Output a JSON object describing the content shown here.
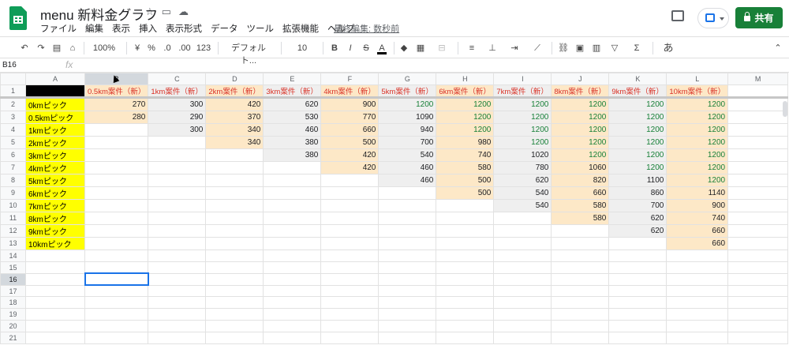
{
  "app": {
    "title": "menu 新料金グラフ",
    "last_edit": "最終編集: 数秒前",
    "share_label": "共有"
  },
  "menu_items": [
    "ファイル",
    "編集",
    "表示",
    "挿入",
    "表示形式",
    "データ",
    "ツール",
    "拡張機能",
    "ヘルプ"
  ],
  "toolbar": {
    "zoom": "100%",
    "currency": "¥",
    "percent": "%",
    "decrease_decimal": ".0",
    "increase_decimal": ".00",
    "number_format": "123",
    "font": "デフォルト...",
    "font_size": "10",
    "input_label": "あ"
  },
  "formula": {
    "cell_ref": "B16",
    "fx_label": "fx"
  },
  "columns": [
    "A",
    "B",
    "C",
    "D",
    "E",
    "F",
    "G",
    "H",
    "I",
    "J",
    "K",
    "L",
    "M"
  ],
  "header_row": [
    "",
    "0.5km案件（新）",
    "1km案件（新）",
    "2km案件（新）",
    "3km案件（新）",
    "4km案件（新）",
    "5km案件（新）",
    "6km案件（新）",
    "7km案件（新）",
    "8km案件（新）",
    "9km案件（新）",
    "10km案件（新）"
  ],
  "rows": [
    [
      "0kmピック",
      "270",
      "300",
      "420",
      "620",
      "900",
      "1200",
      "1200",
      "1200",
      "1200",
      "1200",
      "1200"
    ],
    [
      "0.5kmピック",
      "280",
      "290",
      "370",
      "530",
      "770",
      "1090",
      "1200",
      "1200",
      "1200",
      "1200",
      "1200"
    ],
    [
      "1kmピック",
      "",
      "300",
      "340",
      "460",
      "660",
      "940",
      "1200",
      "1200",
      "1200",
      "1200",
      "1200"
    ],
    [
      "2kmピック",
      "",
      "",
      "340",
      "380",
      "500",
      "700",
      "980",
      "1200",
      "1200",
      "1200",
      "1200"
    ],
    [
      "3kmピック",
      "",
      "",
      "",
      "380",
      "420",
      "540",
      "740",
      "1020",
      "1200",
      "1200",
      "1200"
    ],
    [
      "4kmピック",
      "",
      "",
      "",
      "",
      "420",
      "460",
      "580",
      "780",
      "1060",
      "1200",
      "1200"
    ],
    [
      "5kmピック",
      "",
      "",
      "",
      "",
      "",
      "460",
      "500",
      "620",
      "820",
      "1100",
      "1200"
    ],
    [
      "6kmピック",
      "",
      "",
      "",
      "",
      "",
      "",
      "500",
      "540",
      "660",
      "860",
      "1140"
    ],
    [
      "7kmピック",
      "",
      "",
      "",
      "",
      "",
      "",
      "",
      "540",
      "580",
      "700",
      "900"
    ],
    [
      "8kmピック",
      "",
      "",
      "",
      "",
      "",
      "",
      "",
      "",
      "580",
      "620",
      "740"
    ],
    [
      "9kmピック",
      "",
      "",
      "",
      "",
      "",
      "",
      "",
      "",
      "",
      "620",
      "660"
    ],
    [
      "10kmピック",
      "",
      "",
      "",
      "",
      "",
      "",
      "",
      "",
      "",
      "",
      "660"
    ]
  ],
  "row_numbers": [
    "1",
    "2",
    "3",
    "4",
    "5",
    "6",
    "7",
    "8",
    "9",
    "10",
    "11",
    "12",
    "13",
    "14",
    "15",
    "16",
    "17",
    "18",
    "19",
    "20",
    "21"
  ],
  "active_cell": "B16",
  "colors": {
    "share": "#188038",
    "header_text": "#d93025",
    "green_text": "#188038",
    "yellow_fill": "#ffff00",
    "orange_fill": "#fde8c7",
    "gray_fill": "#efefef"
  }
}
